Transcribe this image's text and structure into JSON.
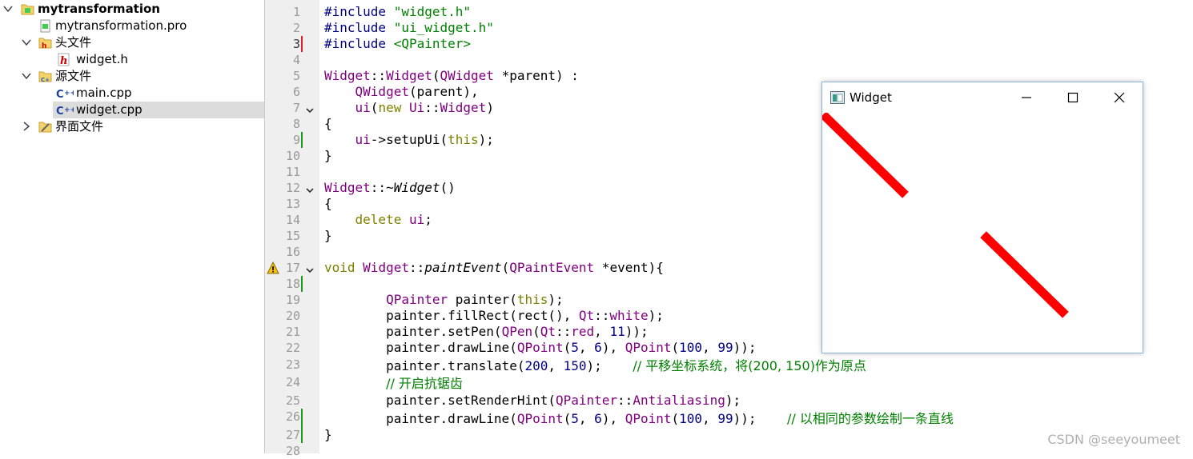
{
  "tree": {
    "project": "mytransformation",
    "pro_file": "mytransformation.pro",
    "headers_folder": "头文件",
    "header_file": "widget.h",
    "sources_folder": "源文件",
    "source_main": "main.cpp",
    "source_widget": "widget.cpp",
    "forms_folder": "界面文件"
  },
  "editor": {
    "line_numbers": [
      "1",
      "2",
      "3",
      "4",
      "5",
      "6",
      "7",
      "8",
      "9",
      "10",
      "11",
      "12",
      "13",
      "14",
      "15",
      "16",
      "17",
      "18",
      "19",
      "20",
      "21",
      "22",
      "23",
      "24",
      "25",
      "26",
      "27",
      "28"
    ],
    "comment_translate": "// 平移坐标系统，将(200, 150)作为原点",
    "comment_antialias": "// 开启抗锯齿",
    "comment_same_params": "// 以相同的参数绘制一条直线"
  },
  "widget_window": {
    "title": "Widget",
    "pen_color": "#ff0000"
  },
  "watermark": "CSDN @seeyoumeet",
  "colors": {
    "keyword": "#808000",
    "type": "#800080",
    "string": "#008000",
    "number": "#000080",
    "comment": "#008000",
    "selection": "#dcdcdc"
  }
}
